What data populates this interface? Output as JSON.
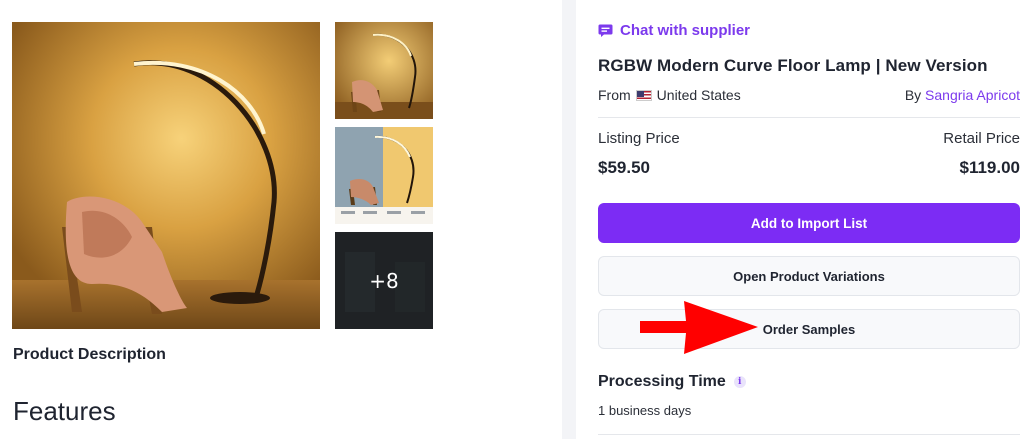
{
  "gallery": {
    "main_image": "floor-lamp-photo",
    "more_count": "+8"
  },
  "description": {
    "title": "Product Description",
    "features_heading": "Features"
  },
  "product": {
    "chat_label": "Chat with supplier",
    "title": "RGBW Modern Curve Floor Lamp | New Version",
    "origin_prefix": "From",
    "origin_country": "United States",
    "supplier_prefix": "By",
    "supplier_name": "Sangria Apricot",
    "listing_price_label": "Listing Price",
    "listing_price": "$59.50",
    "retail_price_label": "Retail Price",
    "retail_price": "$119.00",
    "add_to_import_label": "Add to Import List",
    "open_variations_label": "Open Product Variations",
    "order_samples_label": "Order Samples",
    "processing_time_title": "Processing Time",
    "processing_time_value": "1 business days"
  },
  "colors": {
    "accent": "#7c3aed",
    "primary_button": "#7c2cf4",
    "annotation_arrow": "#ff0000"
  },
  "icons": {
    "chat": "chat-bubble-icon",
    "info": "info-icon",
    "flag": "us-flag-icon",
    "annotation": "red-arrow-annotation"
  }
}
